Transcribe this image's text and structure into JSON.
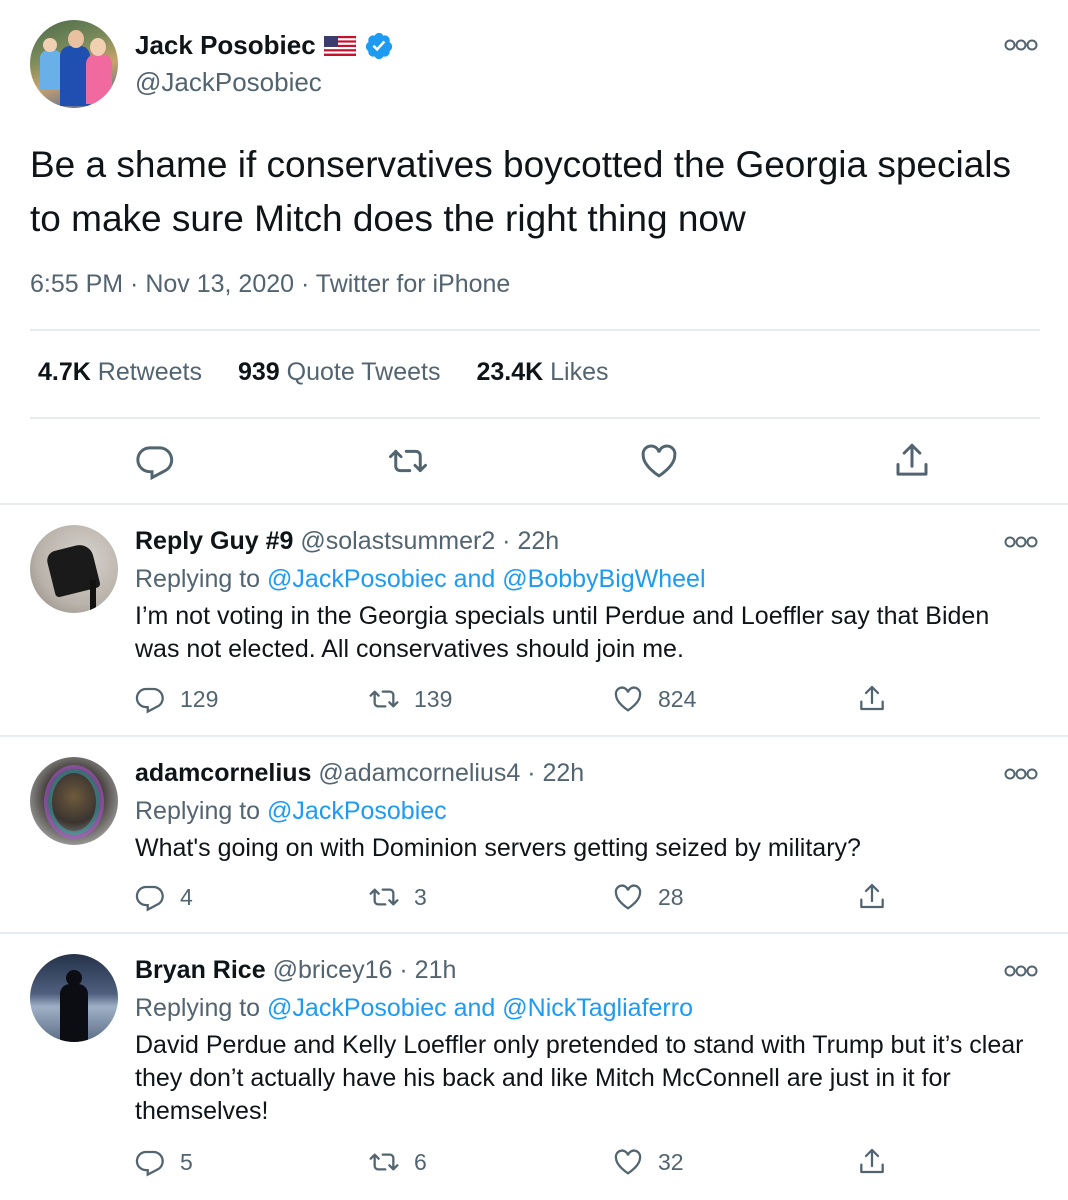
{
  "main_tweet": {
    "display_name": "Jack Posobiec",
    "handle": "@JackPosobiec",
    "text": "Be a shame if conservatives boycotted the Georgia specials to make sure Mitch does the right thing now",
    "meta": "6:55 PM · Nov 13, 2020 · Twitter for iPhone",
    "stats": {
      "retweets_count": "4.7K",
      "retweets_label": "Retweets",
      "quotes_count": "939",
      "quotes_label": "Quote Tweets",
      "likes_count": "23.4K",
      "likes_label": "Likes"
    }
  },
  "replies": [
    {
      "display_name": "Reply Guy #9",
      "handle_time": "@solastsummer2 · 22h",
      "replying_prefix": "Replying to",
      "replying_to": "@JackPosobiec and @BobbyBigWheel",
      "text": "I’m not voting in the Georgia specials until Perdue and Loeffler say that Biden was not elected. All conservatives should join me.",
      "replies": "129",
      "retweets": "139",
      "likes": "824"
    },
    {
      "display_name": "adamcornelius",
      "handle_time": "@adamcornelius4 · 22h",
      "replying_prefix": "Replying to",
      "replying_to": "@JackPosobiec",
      "text": "What's going on with Dominion servers getting seized by military?",
      "replies": "4",
      "retweets": "3",
      "likes": "28"
    },
    {
      "display_name": "Bryan Rice",
      "handle_time": "@bricey16 · 21h",
      "replying_prefix": "Replying to",
      "replying_to": "@JackPosobiec and @NickTagliaferro",
      "text": "David Perdue and Kelly Loeffler only pretended to stand with Trump but it’s clear they don’t actually have his back and like Mitch McConnell are just in it for themselves!",
      "replies": "5",
      "retweets": "6",
      "likes": "32"
    }
  ],
  "colors": {
    "text": "#0f1419",
    "secondary": "#536471",
    "link": "#1d9bf0",
    "border": "#e6ecf0",
    "verified": "#1d9bf0"
  },
  "icons": [
    "verified-badge-icon",
    "us-flag-icon",
    "more-icon",
    "reply-icon",
    "retweet-icon",
    "like-icon",
    "share-icon"
  ]
}
